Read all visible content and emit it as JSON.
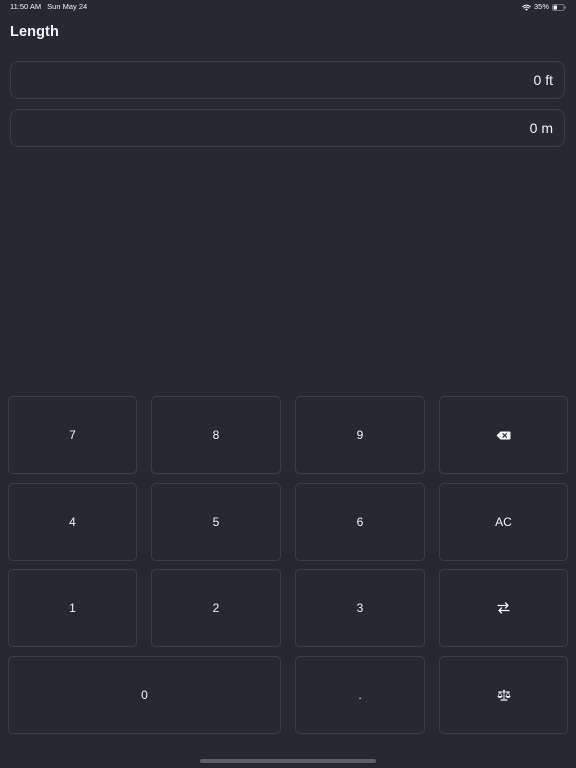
{
  "status_bar": {
    "time": "11:50 AM",
    "date": "Sun May 24",
    "battery": "35%"
  },
  "header": {
    "title": "Length"
  },
  "displays": {
    "feet": "0 ft",
    "meters": "0 m"
  },
  "keypad": {
    "k7": "7",
    "k8": "8",
    "k9": "9",
    "k4": "4",
    "k5": "5",
    "k6": "6",
    "clear": "AC",
    "k1": "1",
    "k2": "2",
    "k3": "3",
    "k0": "0",
    "decimal": ".",
    "icons": {
      "backspace": "backspace-icon",
      "swap": "swap-arrows-icon",
      "scale": "balance-scale-icon"
    }
  },
  "colors": {
    "background": "#262a30",
    "border": "#3a3f47",
    "text": "#f2f3f5"
  }
}
